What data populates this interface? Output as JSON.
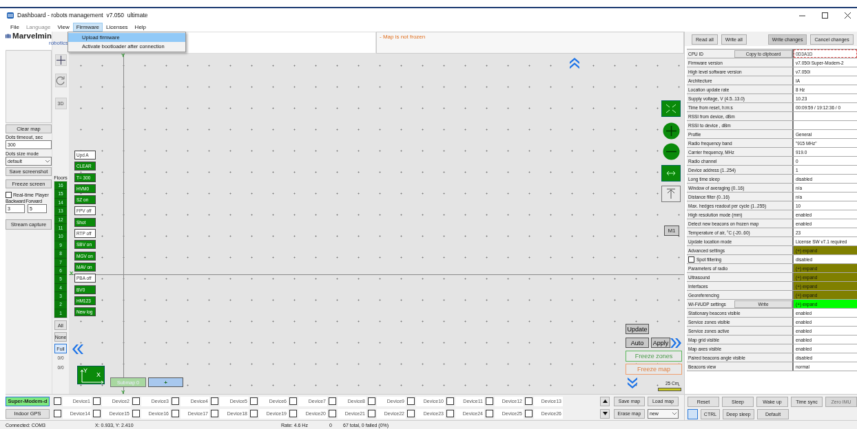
{
  "window": {
    "title": "Dashboard - robots management  v7.050  ultimate"
  },
  "menu": [
    {
      "label": "File",
      "disabled": false,
      "selected": false
    },
    {
      "label": "Language",
      "disabled": true,
      "selected": false
    },
    {
      "label": "View",
      "disabled": false,
      "selected": false
    },
    {
      "label": "Firmware",
      "disabled": false,
      "selected": true
    },
    {
      "label": "Licenses",
      "disabled": false,
      "selected": false
    },
    {
      "label": "Help",
      "disabled": false,
      "selected": false
    }
  ],
  "dropdown": [
    {
      "label": "Upload firmware",
      "selected": true
    },
    {
      "label": "Activate bootloader after connection",
      "selected": false
    }
  ],
  "logo": {
    "name": "Marvelmin",
    "sub": "robotics"
  },
  "left_panel": {
    "clear_map": "Clear map",
    "dots_timeout_label": "Dots timeout, sec",
    "dots_timeout": "300",
    "dots_size_label": "Dots size mode",
    "dots_size": "default",
    "save_screenshot": "Save screenshot",
    "freeze_screen": "Freeze screen",
    "realtime_player": {
      "label": "Real-time Player",
      "checked": false
    },
    "backward_label": "Backward",
    "forward_label": "Forward",
    "backward": "3",
    "forward": "5",
    "stream_capture": "Stream capture"
  },
  "tools": {
    "view_3d": "3D"
  },
  "floors": {
    "label": "Floors",
    "items": [
      "16",
      "15",
      "14",
      "13",
      "12",
      "11",
      "10",
      "9",
      "8",
      "7",
      "6",
      "5",
      "4",
      "3",
      "2",
      "1"
    ],
    "filters": [
      {
        "label": "All",
        "selected": false
      },
      {
        "label": "None",
        "selected": false
      },
      {
        "label": "Full",
        "selected": true
      }
    ],
    "counts": [
      "0/0",
      "0/0"
    ]
  },
  "map": {
    "status": "- Map is not frozen",
    "axis_labels": [
      "Y",
      "X",
      "Y"
    ],
    "toggles": [
      {
        "label": "Upd A",
        "on": false
      },
      {
        "label": "CLEAR",
        "on": true
      },
      {
        "label": "T= 300",
        "on": true
      },
      {
        "label": "HVM0",
        "on": true
      },
      {
        "label": "SZ on",
        "on": true
      },
      {
        "label": "FPV off",
        "on": false
      },
      {
        "label": "Shot",
        "on": true
      },
      {
        "label": "RTP off",
        "on": false
      },
      {
        "label": "SBV on",
        "on": true
      },
      {
        "label": "MGV on",
        "on": true
      },
      {
        "label": "MAV on",
        "on": true
      },
      {
        "label": "PBA off",
        "on": false
      },
      {
        "label": "BV0",
        "on": true
      },
      {
        "label": "HM123",
        "on": true
      },
      {
        "label": "New log",
        "on": true
      }
    ],
    "m1": "M1",
    "update": "Update",
    "auto": "Auto",
    "apply": "Apply",
    "freeze_zones": "Freeze zones",
    "freeze_map": "Freeze map",
    "scale": "25 Cm",
    "axes": {
      "y": "Y",
      "x": "X"
    },
    "submap": "Submap 0",
    "add_submap": "+"
  },
  "modems": [
    {
      "label": "Super-Modem-d",
      "selected": true
    },
    {
      "label": "Indoor GPS",
      "selected": false
    }
  ],
  "devices": [
    {
      "label": "Device1",
      "checked": false
    },
    {
      "label": "Device2",
      "checked": false
    },
    {
      "label": "Device3",
      "checked": false
    },
    {
      "label": "Device4",
      "checked": false
    },
    {
      "label": "Device5",
      "checked": false
    },
    {
      "label": "Device6",
      "checked": false
    },
    {
      "label": "Device7",
      "checked": false
    },
    {
      "label": "Device8",
      "checked": false
    },
    {
      "label": "Device9",
      "checked": false
    },
    {
      "label": "Device10",
      "checked": false
    },
    {
      "label": "Device11",
      "checked": false
    },
    {
      "label": "Device12",
      "checked": false
    },
    {
      "label": "Device13",
      "checked": false
    },
    {
      "label": "Device14",
      "checked": false
    },
    {
      "label": "Device15",
      "checked": false
    },
    {
      "label": "Device16",
      "checked": false
    },
    {
      "label": "Device17",
      "checked": false
    },
    {
      "label": "Device18",
      "checked": false
    },
    {
      "label": "Device19",
      "checked": false
    },
    {
      "label": "Device20",
      "checked": false
    },
    {
      "label": "Device21",
      "checked": false
    },
    {
      "label": "Device22",
      "checked": false
    },
    {
      "label": "Device23",
      "checked": false
    },
    {
      "label": "Device24",
      "checked": false
    },
    {
      "label": "Device25",
      "checked": false
    },
    {
      "label": "Device26",
      "checked": false
    }
  ],
  "map_file": {
    "save": "Save map",
    "load": "Load map",
    "erase": "Erase map",
    "slot": "new"
  },
  "top_buttons": [
    "Read all",
    "Write all",
    "Write changes",
    "Cancel changes"
  ],
  "properties": [
    {
      "kind": "button",
      "label": "CPU ID",
      "button": "Copy to clipboard",
      "value": "0D3A1D",
      "focused": true
    },
    {
      "kind": "plain",
      "label": "Firmware version",
      "value": "v7.050i Super-Modem-2"
    },
    {
      "kind": "plain",
      "label": "High level software version",
      "value": "v7.050i"
    },
    {
      "kind": "plain",
      "label": "Architecture",
      "value": "IA"
    },
    {
      "kind": "plain",
      "label": "Location update rate",
      "value": "8 Hz"
    },
    {
      "kind": "plain",
      "label": "Supply voltage, V (4.5..13.0)",
      "value": "10.23"
    },
    {
      "kind": "plain",
      "label": "Time from reset, h:m:s",
      "value": "00:09:59 / 19:12:36 / 0"
    },
    {
      "kind": "plain",
      "label": "RSSI from device, dBm"
    },
    {
      "kind": "plain",
      "label": "RSSI to device , dBm"
    },
    {
      "kind": "plain",
      "label": "Profile",
      "value": "General"
    },
    {
      "kind": "plain",
      "label": "Radio frequency band",
      "value": "\"915 MHz\""
    },
    {
      "kind": "plain",
      "label": "Carrier frequency, MHz",
      "value": "919.0"
    },
    {
      "kind": "plain",
      "label": "Radio channel",
      "value": "0"
    },
    {
      "kind": "plain",
      "label": "Device address (1..254)",
      "value": "1"
    },
    {
      "kind": "plain",
      "label": "Long time sleep",
      "value": "disabled"
    },
    {
      "kind": "plain",
      "label": "Window of averaging (0..16)",
      "value": "n/a"
    },
    {
      "kind": "plain",
      "label": "Distance filter (0..16)",
      "value": "n/a"
    },
    {
      "kind": "plain",
      "label": "Max. hedges readout per cycle (1..255)",
      "value": "10"
    },
    {
      "kind": "plain",
      "label": "High resolution mode (mm)",
      "value": "enabled"
    },
    {
      "kind": "plain",
      "label": "Detect new beacons on frozen map",
      "value": "enabled"
    },
    {
      "kind": "plain",
      "label": "Temperature of air, °C (-20..60)",
      "value": "23"
    },
    {
      "kind": "plain",
      "label": "Update location mode",
      "value": "License SW v7.1 required"
    },
    {
      "kind": "plain",
      "label": "Advanced settings",
      "value": "(+) expand",
      "color": "#808000"
    },
    {
      "kind": "check",
      "label": "Spot filtering",
      "checked": false,
      "value": "disabled"
    },
    {
      "kind": "plain",
      "label": "Parameters of radio",
      "value": "(+) expand",
      "color": "#808000"
    },
    {
      "kind": "plain",
      "label": "Ultrasound",
      "value": "(+) expand",
      "color": "#808000"
    },
    {
      "kind": "plain",
      "label": "Interfaces",
      "value": "(+) expand",
      "color": "#808000"
    },
    {
      "kind": "plain",
      "label": "Georeferencing",
      "value": "(+) expand",
      "color": "#808000"
    },
    {
      "kind": "button",
      "label": "Wi-Fi/UDP settings",
      "button": "Write",
      "value": "(+) expand",
      "color": "#00ff00"
    },
    {
      "kind": "plain",
      "label": "Stationary beacons visible",
      "value": "enabled"
    },
    {
      "kind": "plain",
      "label": "Service zones visible",
      "value": "enabled"
    },
    {
      "kind": "plain",
      "label": "Service zones active",
      "value": "enabled"
    },
    {
      "kind": "plain",
      "label": "Map grid visible",
      "value": "enabled"
    },
    {
      "kind": "plain",
      "label": "Map axes visible",
      "value": "enabled"
    },
    {
      "kind": "plain",
      "label": "Paired beacons angle visible",
      "value": "disabled"
    },
    {
      "kind": "plain",
      "label": "Beacons view",
      "value": "normal"
    }
  ],
  "device_buttons": [
    {
      "label": "Reset",
      "disabled": false
    },
    {
      "label": "Sleep",
      "disabled": false
    },
    {
      "label": "Wake up",
      "disabled": false
    },
    {
      "label": "Time sync",
      "disabled": false
    },
    {
      "label": "Zero IMU",
      "disabled": true
    }
  ],
  "device_buttons_2": [
    {
      "label": "CTRL",
      "disabled": false
    },
    {
      "label": "Deep sleep",
      "disabled": false
    },
    {
      "label": "Default",
      "disabled": false
    }
  ],
  "status_bar": [
    "Connected: COM3",
    "X: 0.933, Y: 2.410",
    "Rate: 4.6 Hz",
    "0",
    "67 total, 0 failed (0%)"
  ]
}
